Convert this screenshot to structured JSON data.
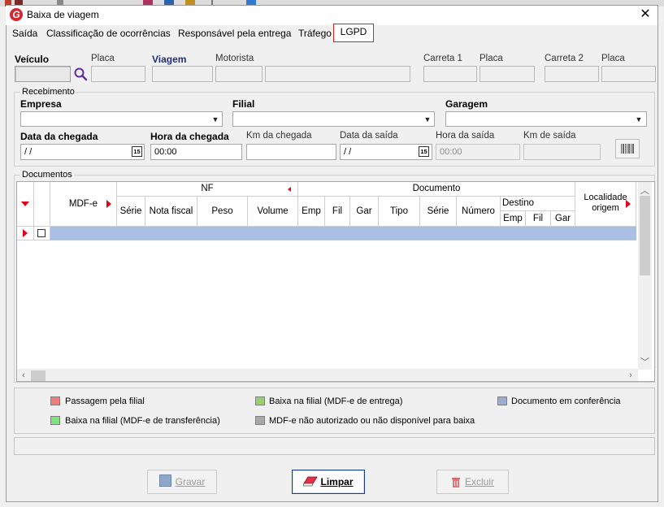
{
  "window": {
    "title": "Baixa de viagem",
    "app_icon_letter": "G"
  },
  "menu": [
    {
      "label": "Saída"
    },
    {
      "label": "Classificação de ocorrências"
    },
    {
      "label": "Responsável pela entrega"
    },
    {
      "label": "Tráfego"
    },
    {
      "label": "LGPD",
      "active": true
    }
  ],
  "vehicle": {
    "veiculo_label": "Veículo",
    "placa_label": "Placa",
    "viagem_label": "Viagem",
    "motorista_label": "Motorista",
    "carreta1_label": "Carreta 1",
    "placa2_label": "Placa",
    "carreta2_label": "Carreta 2",
    "placa3_label": "Placa"
  },
  "recebimento": {
    "title": "Recebimento",
    "empresa_label": "Empresa",
    "filial_label": "Filial",
    "garagem_label": "Garagem",
    "data_chegada_label": "Data da chegada",
    "data_chegada_value": " / /",
    "hora_chegada_label": "Hora da chegada",
    "hora_chegada_value": "00:00",
    "km_chegada_label": "Km da chegada",
    "data_saida_label": "Data da saída",
    "data_saida_value": " / /",
    "hora_saida_label": "Hora da saída",
    "hora_saida_value": "00:00",
    "km_saida_label": "Km de saída",
    "calendar_icon_text": "15"
  },
  "documentos": {
    "title": "Documentos",
    "headers": {
      "mdfe": "MDF-e",
      "nf": "NF",
      "serie": "Série",
      "nota_fiscal": "Nota fiscal",
      "peso": "Peso",
      "volume": "Volume",
      "documento": "Documento",
      "emp": "Emp",
      "fil": "Fil",
      "gar": "Gar",
      "tipo": "Tipo",
      "serie2": "Série",
      "numero": "Número",
      "destino": "Destino",
      "dest_emp": "Emp",
      "dest_fil": "Fil",
      "dest_gar": "Gar",
      "localidade_origem_1": "Localidade",
      "localidade_origem_2": "origem"
    }
  },
  "legend": [
    {
      "label": "Passagem pela filial",
      "color": "#f07d7d"
    },
    {
      "label": "Baixa na filial (MDF-e de entrega)",
      "color": "#97d36e"
    },
    {
      "label": "Documento em conferência",
      "color": "#9badd0"
    },
    {
      "label": "Baixa na filial (MDF-e de transferência)",
      "color": "#7ee07e"
    },
    {
      "label": "MDF-e não autorizado ou não disponível para baixa",
      "color": "#a8a8a8"
    }
  ],
  "actions": {
    "gravar_label": "Gravar",
    "limpar_label": "Limpar",
    "excluir_label": "Excluir"
  },
  "colors": {
    "accent_red": "#e0001a",
    "selected_row": "#a9bfe6",
    "primary_border": "#1c3f8a"
  }
}
